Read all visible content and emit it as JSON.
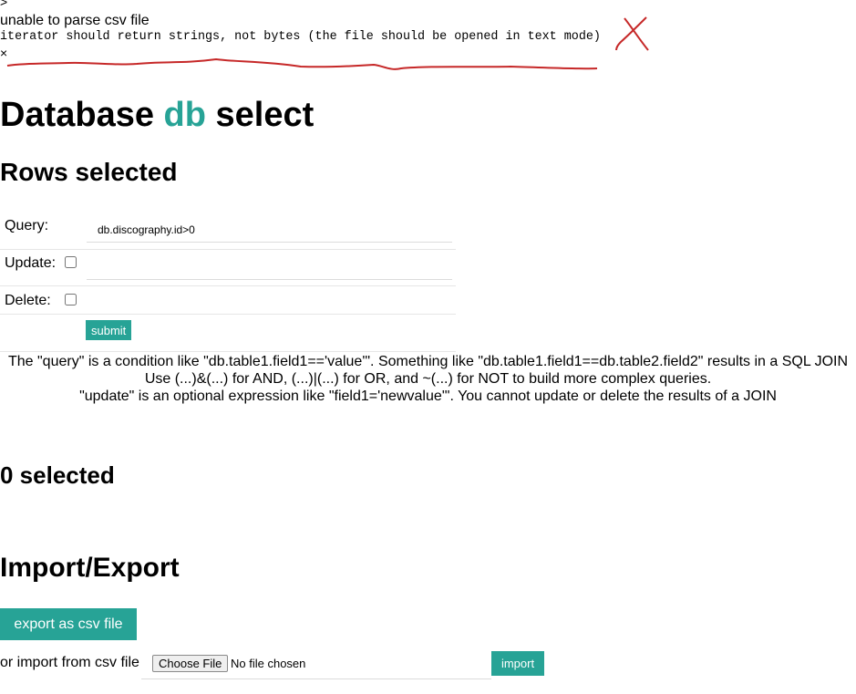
{
  "flash": {
    "prefix": ">",
    "title": "unable to parse csv file",
    "message": "iterator should return strings, not bytes (the file should be opened in text mode)",
    "close": "×"
  },
  "heading": {
    "part1": "Database ",
    "db": "db",
    "part2": " select"
  },
  "rows_heading": "Rows selected",
  "form": {
    "query_label": "Query:",
    "query_value": "db.discography.id>0",
    "update_label": "Update:",
    "update_value": "",
    "delete_label": "Delete:",
    "submit_label": "submit"
  },
  "help": {
    "line1": "The \"query\" is a condition like \"db.table1.field1=='value'\". Something like \"db.table1.field1==db.table2.field2\" results in a SQL JOIN",
    "line2": "Use (...)&(...) for AND, (...)|(...) for OR, and ~(...) for NOT to build more complex queries.",
    "line3": "\"update\" is an optional expression like \"field1='newvalue'\". You cannot update or delete the results of a JOIN"
  },
  "count_heading": "0 selected",
  "import_export": {
    "heading": "Import/Export",
    "export_label": "export as csv file",
    "import_text": "or import from csv file",
    "choose_label": "Choose File",
    "no_file": "No file chosen",
    "import_label": "import"
  },
  "colors": {
    "accent": "#27a396",
    "annotation": "#c62828"
  },
  "icons": {
    "annotation_mark": "red-x-mark"
  }
}
